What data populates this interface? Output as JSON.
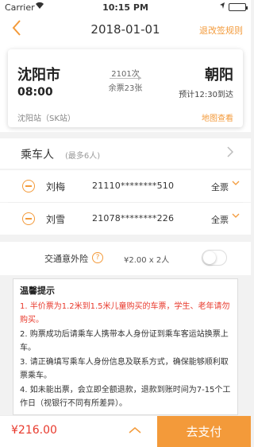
{
  "status_bar": {
    "carrier": "Carrier",
    "time": "10:15 PM"
  },
  "nav": {
    "title": "2018-01-01",
    "rule_link": "退改签规则"
  },
  "ticket": {
    "from_city": "沈阳市",
    "departure_time": "08:00",
    "station": "沈阳站（SK站）",
    "train_no": "2101次",
    "remaining": "余票23张",
    "to_city": "朝阳",
    "arrival": "预计12:30到达",
    "map_link": "地图查看"
  },
  "passengers": {
    "label": "乘车人",
    "hint": "(最多6人)",
    "list": [
      {
        "name": "刘梅",
        "id": "21110********510",
        "type": "全票"
      },
      {
        "name": "刘雪",
        "id": "21078********226",
        "type": "全票"
      }
    ]
  },
  "insurance": {
    "label": "交通意外险",
    "price": "¥2.00 x 2人",
    "enabled": false
  },
  "notice": {
    "title": "温馨提示",
    "items": [
      "1. 半价票为1.2米到1.5米儿童购买的车票，学生、老年请勿购买。",
      "2. 购票成功后请乘车人携带本人身份证到乘车客运站换票上车。",
      "3. 请正确填写乘车人身份信息及联系方式，确保能够顺利取票乘车。",
      "4. 如未能出票，会立即全额退款，退款到账时间为7-15个工作日（视银行不同有所差异）。"
    ]
  },
  "footer": {
    "total": "¥216.00",
    "pay_label": "去支付"
  },
  "colors": {
    "accent": "#f39a3a",
    "warning": "#e8392c"
  }
}
